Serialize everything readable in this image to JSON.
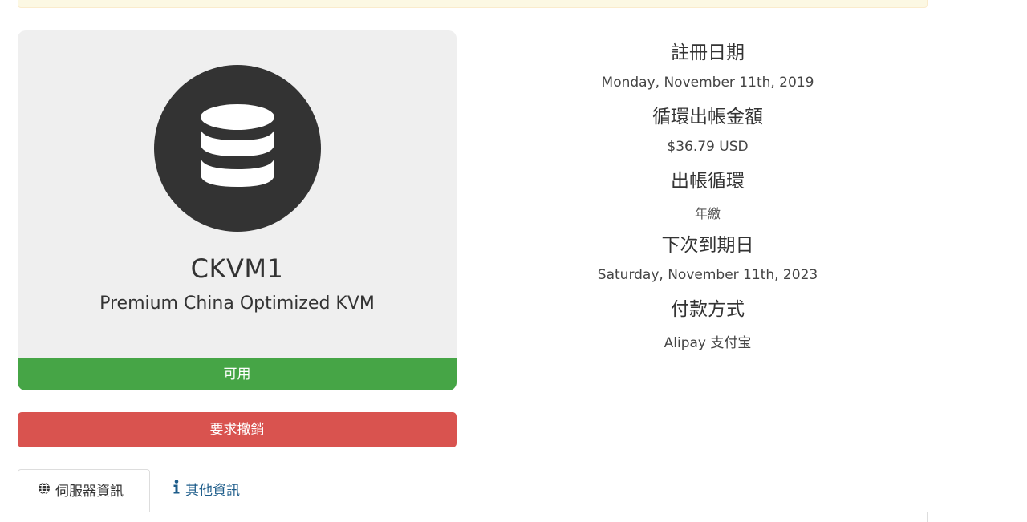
{
  "product": {
    "icon": "database-icon",
    "name": "CKVM1",
    "description": "Premium China Optimized KVM",
    "status": "可用"
  },
  "actions": {
    "cancel_label": "要求撤銷"
  },
  "details": {
    "registration_label": "註冊日期",
    "registration_value": "Monday, November 11th, 2019",
    "recurring_label": "循環出帳金額",
    "recurring_value": "$36.79 USD",
    "cycle_label": "出帳循環",
    "cycle_value": "年繳",
    "due_label": "下次到期日",
    "due_value": "Saturday, November 11th, 2023",
    "payment_label": "付款方式",
    "payment_value": "Alipay 支付宝"
  },
  "tabs": [
    {
      "label": "伺服器資訊",
      "icon": "globe-icon",
      "active": true
    },
    {
      "label": "其他資訊",
      "icon": "info-icon",
      "active": false
    }
  ],
  "colors": {
    "status_green": "#46a546",
    "danger_red": "#d9534f",
    "card_bg": "#efefef",
    "icon_circle": "#333333",
    "tab_link": "#1d5c8a"
  }
}
